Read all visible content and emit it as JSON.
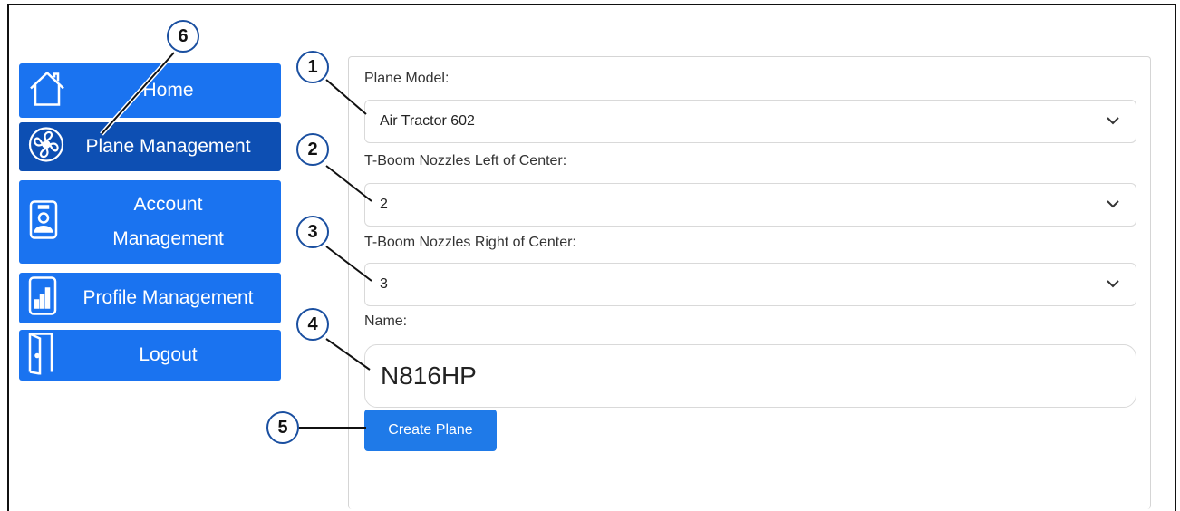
{
  "sidebar": {
    "items": [
      {
        "label": "Home",
        "icon": "home-icon"
      },
      {
        "label": "Plane Management",
        "icon": "fan-icon"
      },
      {
        "label": "Account Management",
        "line1": "Account",
        "line2": "Management",
        "icon": "badge-icon"
      },
      {
        "label": "Profile Management",
        "icon": "chart-icon"
      },
      {
        "label": "Logout",
        "icon": "door-icon"
      }
    ]
  },
  "form": {
    "plane_model": {
      "label": "Plane Model:",
      "value": "Air Tractor 602"
    },
    "left_nozzles": {
      "label": "T-Boom Nozzles Left of Center:",
      "value": "2"
    },
    "right_nozzles": {
      "label": "T-Boom Nozzles Right of Center:",
      "value": "3"
    },
    "name": {
      "label": "Name:",
      "value": "N816HP"
    },
    "submit_label": "Create Plane"
  },
  "callouts": [
    "1",
    "2",
    "3",
    "4",
    "5",
    "6"
  ],
  "colors": {
    "button_blue": "#1a73f0",
    "button_active": "#0d4fb3",
    "callout_ring": "#1a4fa0"
  }
}
